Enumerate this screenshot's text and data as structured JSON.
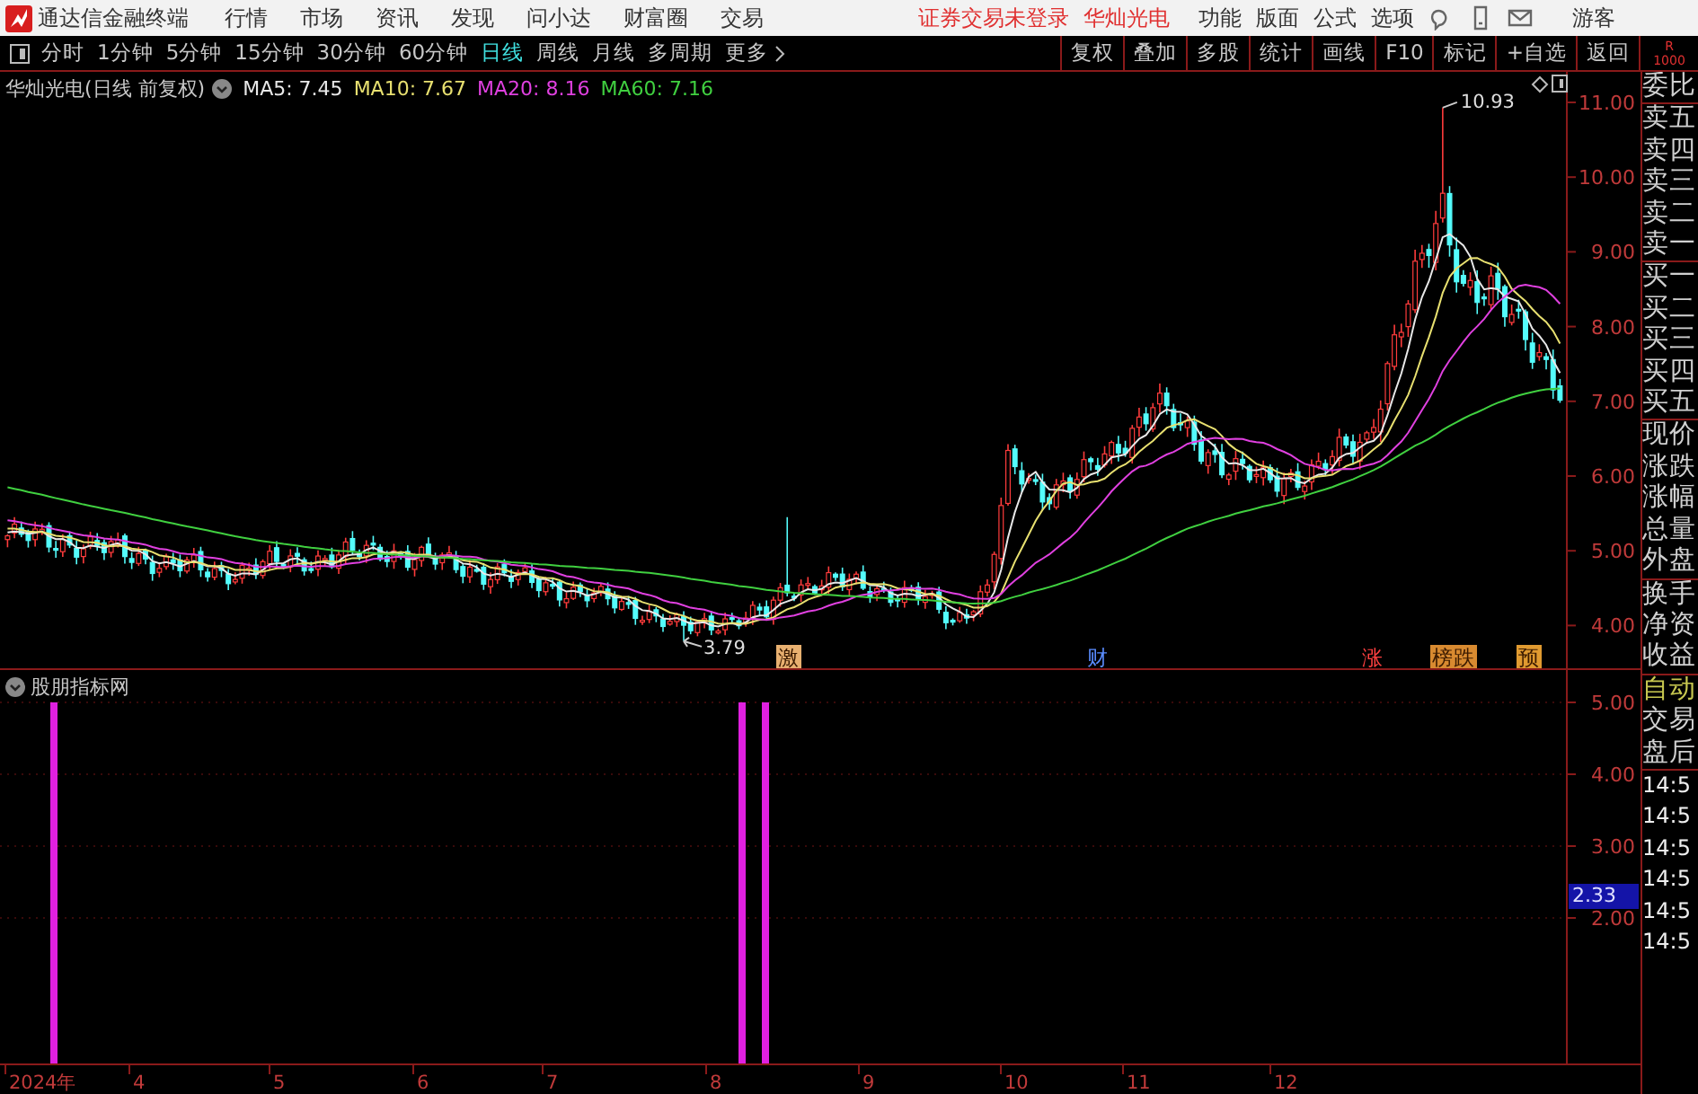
{
  "app": {
    "title": "通达信金融终端",
    "menu": [
      "行情",
      "市场",
      "资讯",
      "发现",
      "问小达",
      "财富圈",
      "交易"
    ],
    "notice": "证券交易未登录",
    "stock_link": "华灿光电",
    "right_menu": [
      "功能",
      "版面",
      "公式",
      "选项"
    ],
    "user": "游客"
  },
  "period_tabs": [
    {
      "label": "分时",
      "selected": false
    },
    {
      "label": "1分钟",
      "selected": false
    },
    {
      "label": "5分钟",
      "selected": false
    },
    {
      "label": "15分钟",
      "selected": false
    },
    {
      "label": "30分钟",
      "selected": false
    },
    {
      "label": "60分钟",
      "selected": false
    },
    {
      "label": "日线",
      "selected": true
    },
    {
      "label": "周线",
      "selected": false
    },
    {
      "label": "月线",
      "selected": false
    },
    {
      "label": "多周期",
      "selected": false
    },
    {
      "label": "更多",
      "selected": false
    }
  ],
  "tools": [
    "复权",
    "叠加",
    "多股",
    "统计",
    "画线",
    "F10",
    "标记",
    "+自选",
    "返回"
  ],
  "corner": [
    "R",
    "1000"
  ],
  "main_chart": {
    "title": "华灿光电(日线 前复权)",
    "ma": [
      {
        "label": "MA5: 7.45",
        "color": "#e8e8e8"
      },
      {
        "label": "MA10: 7.67",
        "color": "#e8e070"
      },
      {
        "label": "MA20: 8.16",
        "color": "#e040e0"
      },
      {
        "label": "MA60: 7.16",
        "color": "#40d040"
      }
    ],
    "y_ticks": [
      "11.00",
      "10.00",
      "9.00",
      "8.00",
      "7.00",
      "6.00",
      "5.00",
      "4.00"
    ],
    "high_label": "10.93",
    "low_label": "3.79",
    "markers": [
      {
        "text": "激",
        "kind": "filled",
        "color": "#e8b070"
      },
      {
        "text": "财",
        "kind": "plain",
        "color": "#5a8cff"
      },
      {
        "text": "涨",
        "kind": "plain",
        "color": "#ff4040"
      },
      {
        "text": "榜跌",
        "kind": "filled",
        "color": "#d88a30"
      },
      {
        "text": "预",
        "kind": "filled",
        "color": "#e09a30"
      }
    ]
  },
  "indicator": {
    "title": "股朋指标网",
    "y_ticks": [
      "5.00",
      "4.00",
      "3.00",
      "2.00"
    ],
    "cursor_value": "2.33"
  },
  "x_axis": [
    "2024年",
    "4",
    "5",
    "6",
    "7",
    "8",
    "9",
    "10",
    "11",
    "12"
  ],
  "side_panel": {
    "groups": [
      [
        "委比"
      ],
      [
        "卖五",
        "卖四",
        "卖三",
        "卖二",
        "卖一"
      ],
      [
        "买一",
        "买二",
        "买三",
        "买四",
        "买五"
      ],
      [
        "现价",
        "涨跌",
        "涨幅",
        "总量",
        "外盘"
      ],
      [
        "换手",
        "净资",
        "收益"
      ]
    ],
    "auto": "自动",
    "rows": [
      "交易",
      "盘后"
    ],
    "times": [
      "14:5",
      "14:5",
      "14:5",
      "14:5",
      "14:5",
      "14:5"
    ]
  }
}
